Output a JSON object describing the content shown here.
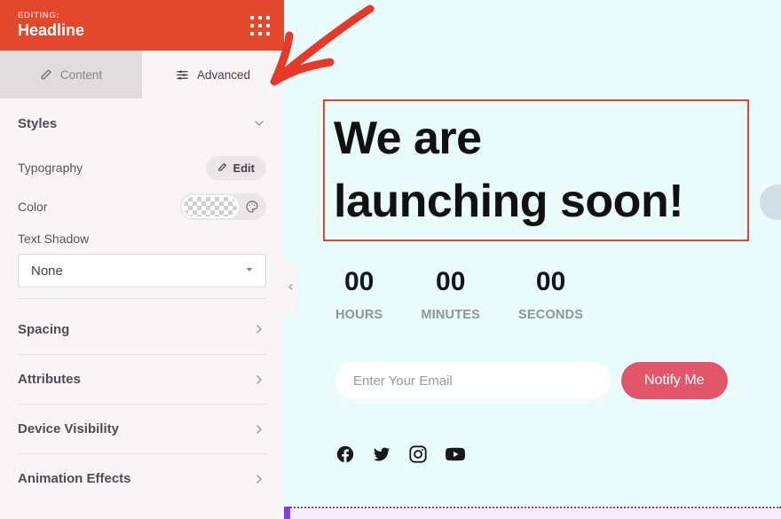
{
  "panel": {
    "header": {
      "editing_label": "EDITING:",
      "title": "Headline",
      "drag_handle_icon": "dots-grid-icon",
      "background_color": "#e1482c"
    },
    "tabs": [
      {
        "label": "Content",
        "icon": "pencil-icon",
        "active": false
      },
      {
        "label": "Advanced",
        "icon": "sliders-icon",
        "active": true
      }
    ],
    "styles_section": {
      "title": "Styles",
      "expanded": true,
      "chevron_icon": "chevron-down-icon",
      "typography": {
        "label": "Typography",
        "edit_button_label": "Edit",
        "edit_button_icon": "pencil-icon"
      },
      "color": {
        "label": "Color",
        "value": "transparent",
        "palette_icon": "palette-icon"
      },
      "text_shadow": {
        "label": "Text Shadow",
        "value": "None",
        "caret_icon": "chevron-down-icon"
      }
    },
    "sections": [
      {
        "title": "Spacing",
        "chevron_icon": "chevron-right-icon"
      },
      {
        "title": "Attributes",
        "chevron_icon": "chevron-right-icon"
      },
      {
        "title": "Device Visibility",
        "chevron_icon": "chevron-right-icon"
      },
      {
        "title": "Animation Effects",
        "chevron_icon": "chevron-right-icon"
      }
    ],
    "collapse_handle_icon": "chevron-left-icon"
  },
  "canvas": {
    "background_color": "#eafcfc",
    "selection_color": "#e1482c",
    "headline": {
      "line1": "We are",
      "line2": "launching soon!"
    },
    "countdown": [
      {
        "value": "00",
        "label": "HOURS"
      },
      {
        "value": "00",
        "label": "MINUTES"
      },
      {
        "value": "00",
        "label": "SECONDS"
      }
    ],
    "subscribe": {
      "email_placeholder": "Enter Your Email",
      "email_value": "",
      "button_label": "Notify Me",
      "button_color": "#e2566a"
    },
    "social_icons": [
      {
        "name": "facebook-icon"
      },
      {
        "name": "twitter-icon"
      },
      {
        "name": "instagram-icon"
      },
      {
        "name": "youtube-icon"
      }
    ],
    "section_boundary_color": "#7b3fe4"
  },
  "annotation": {
    "arrow_color": "#e8382a",
    "points_to": "Advanced"
  }
}
